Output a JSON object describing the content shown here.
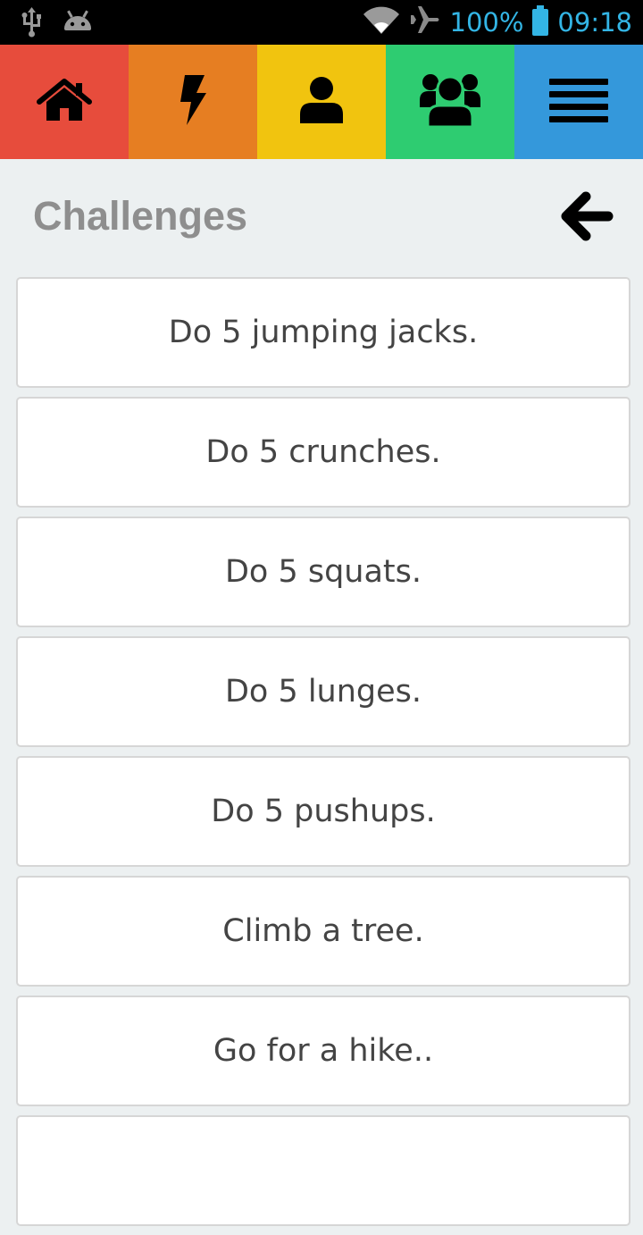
{
  "status_bar": {
    "icons": [
      "usb-icon",
      "android-icon",
      "wifi-icon",
      "airplane-icon",
      "battery-icon"
    ],
    "battery": "100%",
    "time": "09:18",
    "text_color": "#33b5e5"
  },
  "nav": {
    "tabs": [
      {
        "icon": "home-icon",
        "color": "#e74c3c"
      },
      {
        "icon": "lightning-icon",
        "color": "#e67e22"
      },
      {
        "icon": "user-icon",
        "color": "#f1c40f"
      },
      {
        "icon": "group-icon",
        "color": "#2ecc71"
      },
      {
        "icon": "menu-icon",
        "color": "#3498db"
      }
    ]
  },
  "header": {
    "title": "Challenges",
    "back_icon": "arrow-left-icon"
  },
  "challenges": [
    "Do 5 jumping jacks.",
    "Do 5 crunches.",
    "Do 5 squats.",
    "Do 5 lunges.",
    "Do 5 pushups.",
    "Climb a tree.",
    "Go for a hike..",
    ""
  ]
}
